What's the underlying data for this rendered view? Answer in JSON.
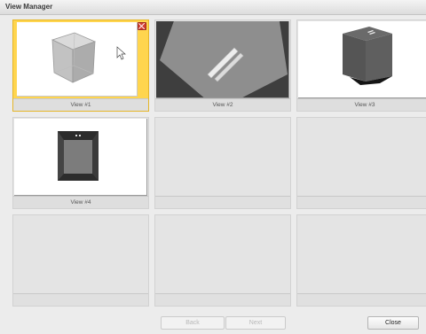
{
  "window": {
    "title": "View Manager"
  },
  "views": [
    {
      "caption": "View #1",
      "selected": true
    },
    {
      "caption": "View #2",
      "selected": false
    },
    {
      "caption": "View #3",
      "selected": false
    },
    {
      "caption": "View #4",
      "selected": false
    }
  ],
  "buttons": {
    "back": "Back",
    "next": "Next",
    "close": "Close"
  },
  "colors": {
    "selection": "#ffd54e",
    "delete": "#d43c2f"
  }
}
